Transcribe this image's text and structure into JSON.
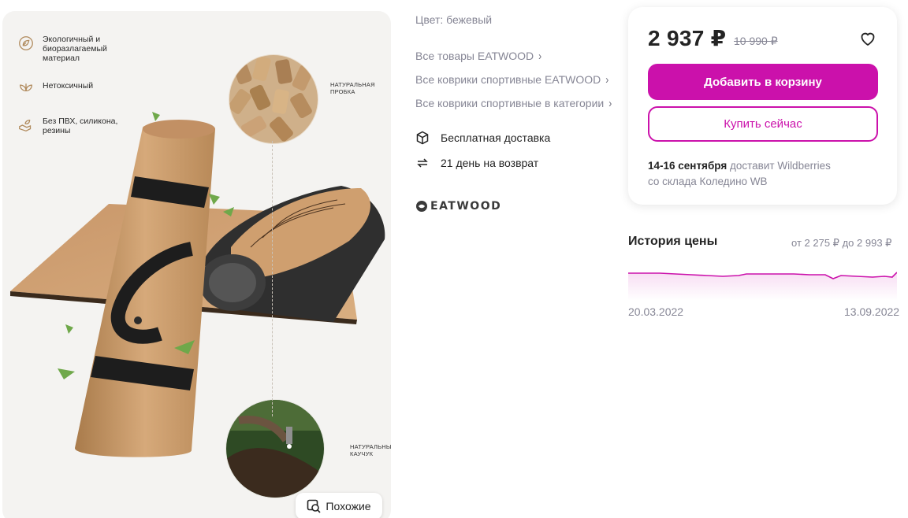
{
  "gallery": {
    "features": [
      {
        "icon": "recycle-leaf-icon",
        "text": "Экологичный и биоразлагаемый материал"
      },
      {
        "icon": "leaf-icon",
        "text": "Нетоксичный"
      },
      {
        "icon": "hand-leaf-icon",
        "text": "Без ПВХ, силикона, резины"
      }
    ],
    "callout_top": "НАТУРАЛЬНАЯ ПРОБКА",
    "callout_bottom": "НАТУРАЛЬНЫЙ КАУЧУК",
    "mat_brand": "EATWOOD",
    "similar_label": "Похожие"
  },
  "details": {
    "color_label": "Цвет:",
    "color_value": "бежевый",
    "links": [
      "Все товары EATWOOD",
      "Все коврики спортивные EATWOOD",
      "Все коврики спортивные в категории"
    ],
    "perks": [
      {
        "icon": "box-icon",
        "text": "Бесплатная доставка"
      },
      {
        "icon": "return-arrows-icon",
        "text": "21 день на возврат"
      }
    ],
    "brand_logo": "EATWOOD"
  },
  "card": {
    "price": "2 937 ₽",
    "old_price": "10 990 ₽",
    "add_to_cart": "Добавить в корзину",
    "buy_now": "Купить сейчас",
    "delivery_date": "14-16 сентября",
    "delivery_by": "доставит Wildberries",
    "delivery_from": "со склада Коледино WB"
  },
  "price_history": {
    "title": "История цены",
    "range_from_label": "от",
    "range_from": "2 275 ₽",
    "range_to_label": "до",
    "range_to": "2 993 ₽",
    "date_start": "20.03.2022",
    "date_end": "13.09.2022",
    "line_color": "#cb11ab"
  },
  "colors": {
    "accent": "#cb11ab",
    "muted_text": "#868695",
    "text": "#242424"
  }
}
